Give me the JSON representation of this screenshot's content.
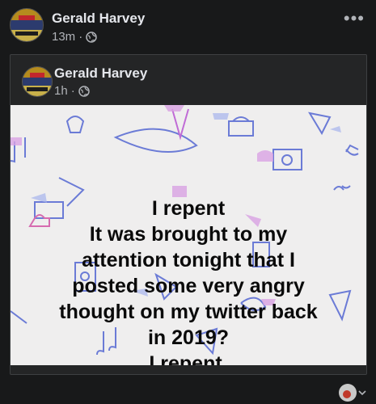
{
  "post": {
    "author": "Gerald Harvey",
    "time": "13m",
    "more_icon": "•••"
  },
  "shared_post": {
    "author": "Gerald Harvey",
    "time": "1h",
    "image_text": [
      "I repent",
      "It was brought to my",
      "attention tonight that I",
      "posted some very angry",
      "thought on my twitter back",
      "in 2019?",
      "I repent."
    ],
    "background_color": "#efeeee"
  },
  "colors": {
    "page_bg": "#18191a",
    "card_border": "#3e4042",
    "name": "#e4e6eb",
    "meta": "#b0b3b8"
  }
}
